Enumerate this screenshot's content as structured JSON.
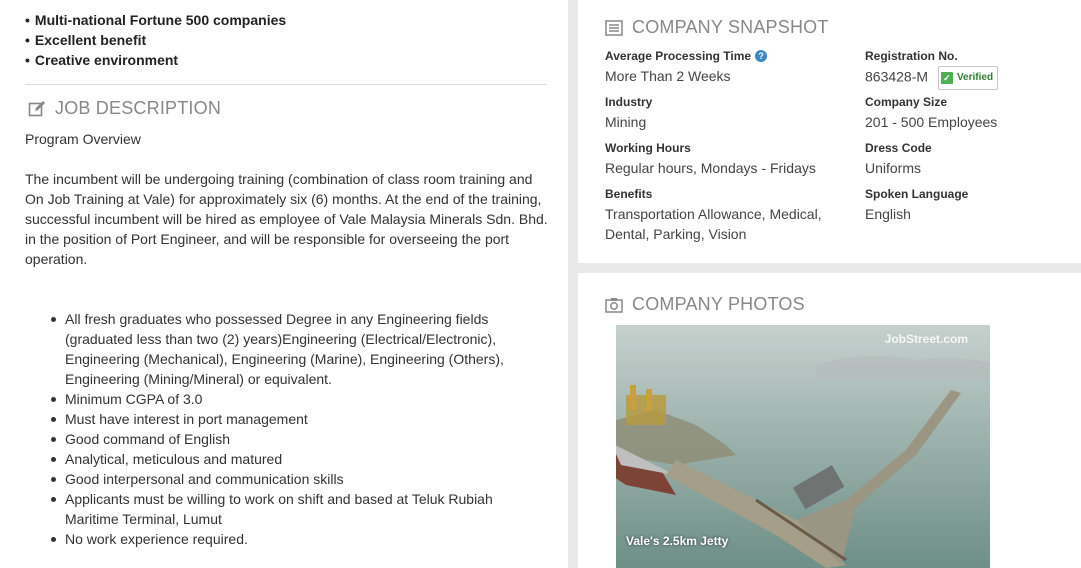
{
  "highlights": [
    "Multi-national Fortune 500 companies",
    "Excellent benefit",
    "Creative environment"
  ],
  "job_description": {
    "heading": "JOB DESCRIPTION",
    "overview_title": "Program Overview",
    "intro": "The incumbent will be undergoing training (combination of class room training and On Job Training at Vale) for approximately six (6) months. At the end of the training, successful incumbent will be hired as employee of Vale Malaysia Minerals Sdn. Bhd. in the position of Port Engineer, and will be responsible for overseeing the port operation.",
    "requirements": [
      "All fresh graduates who possessed Degree in any Engineering fields (graduated less than two (2) years)Engineering (Electrical/Electronic), Engineering (Mechanical), Engineering (Marine), Engineering (Others), Engineering (Mining/Mineral) or equivalent.",
      "Minimum CGPA of 3.0",
      "Must have interest in port management",
      "Good command of English",
      "Analytical, meticulous and matured",
      "Good interpersonal and communication skills",
      "Applicants must be willing to work on shift and based at Teluk Rubiah Maritime Terminal, Lumut",
      "No work experience required."
    ]
  },
  "snapshot": {
    "heading": "COMPANY SNAPSHOT",
    "avg_processing_label": "Average Processing Time",
    "avg_processing_value": "More Than 2 Weeks",
    "registration_label": "Registration No.",
    "registration_value": "863428-M",
    "verified_label": "Verified",
    "industry_label": "Industry",
    "industry_value": "Mining",
    "company_size_label": "Company Size",
    "company_size_value": "201 - 500 Employees",
    "working_hours_label": "Working Hours",
    "working_hours_value": "Regular hours, Mondays - Fridays",
    "dress_code_label": "Dress Code",
    "dress_code_value": "Uniforms",
    "benefits_label": "Benefits",
    "benefits_value": "Transportation Allowance, Medical, Dental, Parking, Vision",
    "language_label": "Spoken Language",
    "language_value": "English",
    "help_glyph": "?"
  },
  "photos": {
    "heading": "COMPANY PHOTOS",
    "watermark": "JobStreet.com",
    "caption": "Vale's 2.5km Jetty"
  },
  "icons": {
    "edit": "edit-icon",
    "list": "list-icon",
    "camera": "camera-icon"
  },
  "colors": {
    "heading_grey": "#888888",
    "help_blue": "#3c87c6",
    "verified_green": "#4caf50"
  }
}
